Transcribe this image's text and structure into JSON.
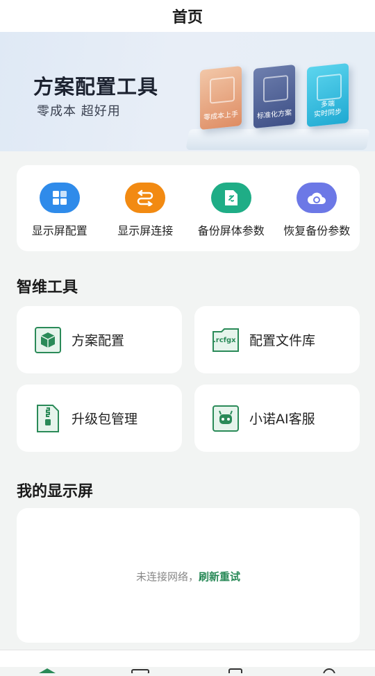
{
  "header": {
    "title": "首页"
  },
  "banner": {
    "title": "方案配置工具",
    "subtitle": "零成本 超好用",
    "cards": [
      "零成本上手",
      "标准化方案",
      "多端\n实时同步"
    ]
  },
  "quick_actions": [
    {
      "label": "显示屏配置",
      "icon": "grid-icon",
      "color": "#2f8bea"
    },
    {
      "label": "显示屏连接",
      "icon": "swap-arrows-icon",
      "color": "#f28a12"
    },
    {
      "label": "备份屏体参数",
      "icon": "link-document-icon",
      "color": "#1fad86"
    },
    {
      "label": "恢复备份参数",
      "icon": "cloud-sync-icon",
      "color": "#6c78e6"
    }
  ],
  "tools_section": {
    "title": "智维工具",
    "items": [
      {
        "label": "方案配置",
        "icon": "cube-icon"
      },
      {
        "label": "配置文件库",
        "icon": "rcfgx-folder-icon",
        "badge": ".rcfgx"
      },
      {
        "label": "升级包管理",
        "icon": "zip-file-icon"
      },
      {
        "label": "小诺AI客服",
        "icon": "robot-icon"
      }
    ]
  },
  "my_display": {
    "title": "我的显示屏",
    "empty_message": "未连接网络，",
    "retry_label": "刷新重试"
  },
  "colors": {
    "accent": "#2a8a58",
    "background": "#f2f4f3"
  }
}
